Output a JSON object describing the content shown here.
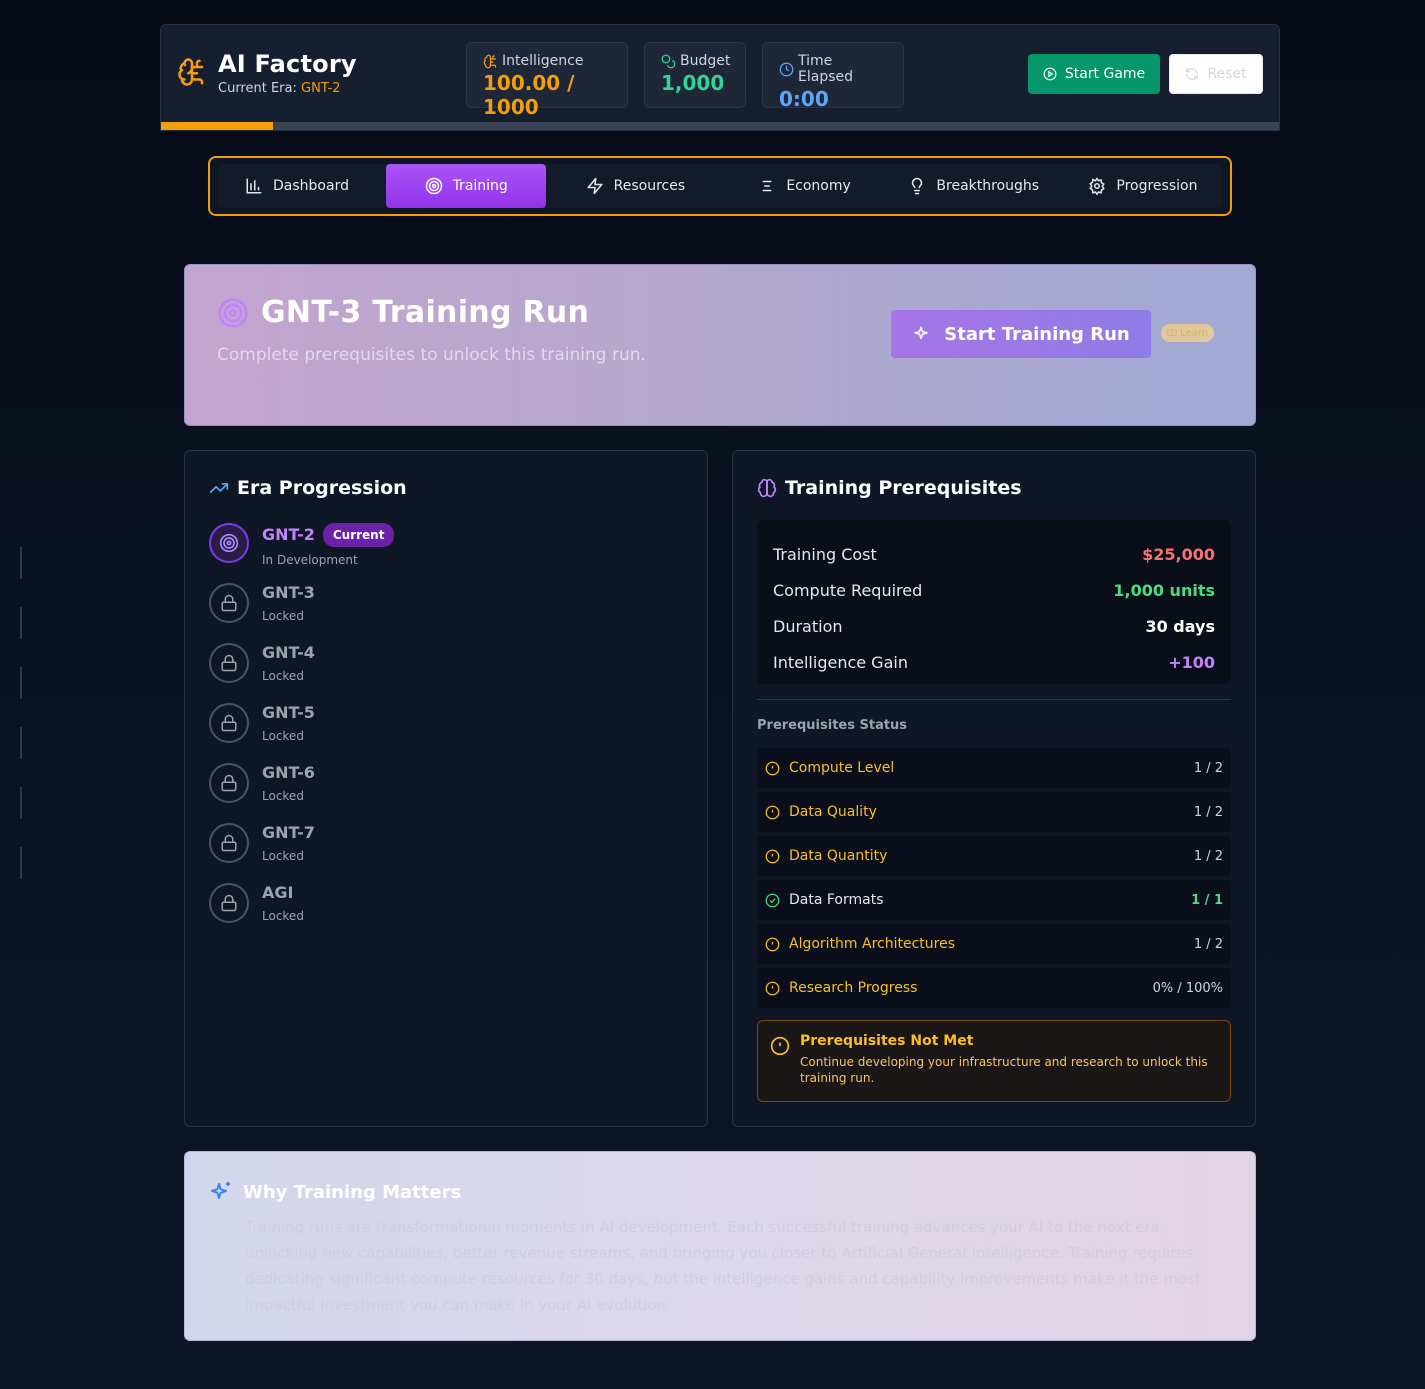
{
  "header": {
    "title": "AI Factory",
    "era_label": "Current Era:",
    "era_value": "GNT-2",
    "stats": [
      {
        "label": "Intelligence",
        "value": "100.00 / 1000",
        "icon": "brain-icon"
      },
      {
        "label": "Budget",
        "value": "1,000",
        "icon": "coins-icon"
      },
      {
        "label": "Time Elapsed",
        "value": "0:00",
        "icon": "clock-icon"
      }
    ],
    "start_label": "Start Game",
    "reset_label": "Reset",
    "progress_fraction": 0.1
  },
  "tabs": [
    {
      "label": "Dashboard",
      "icon": "bar-chart-icon",
      "active": false
    },
    {
      "label": "Training",
      "icon": "target-icon",
      "active": true
    },
    {
      "label": "Resources",
      "icon": "lightning-icon",
      "active": false
    },
    {
      "label": "Economy",
      "icon": "lines-icon",
      "active": false
    },
    {
      "label": "Breakthroughs",
      "icon": "lightbulb-icon",
      "active": false
    },
    {
      "label": "Progression",
      "icon": "gear-icon",
      "active": false
    }
  ],
  "hero": {
    "title": "GNT-3 Training Run",
    "subtitle": "Complete prerequisites to unlock this training run.",
    "button_label": "Start Training Run",
    "learn_label": "Learn"
  },
  "era_progression": {
    "title": "Era Progression",
    "items": [
      {
        "name": "GNT-2",
        "status": "In Development",
        "badge": "Current",
        "current": true
      },
      {
        "name": "GNT-3",
        "status": "Locked"
      },
      {
        "name": "GNT-4",
        "status": "Locked"
      },
      {
        "name": "GNT-5",
        "status": "Locked"
      },
      {
        "name": "GNT-6",
        "status": "Locked"
      },
      {
        "name": "GNT-7",
        "status": "Locked"
      },
      {
        "name": "AGI",
        "status": "Locked"
      }
    ]
  },
  "prerequisites": {
    "title": "Training Prerequisites",
    "costs": [
      {
        "label": "Training Cost",
        "value": "$25,000",
        "color": "#f87171"
      },
      {
        "label": "Compute Required",
        "value": "1,000 units",
        "color": "#4ade80"
      },
      {
        "label": "Duration",
        "value": "30 days",
        "color": "#ffffff"
      },
      {
        "label": "Intelligence Gain",
        "value": "+100",
        "color": "#c084fc"
      }
    ],
    "status_heading": "Prerequisites Status",
    "status": [
      {
        "label": "Compute Level",
        "value": "1 / 2",
        "met": false
      },
      {
        "label": "Data Quality",
        "value": "1 / 2",
        "met": false
      },
      {
        "label": "Data Quantity",
        "value": "1 / 2",
        "met": false
      },
      {
        "label": "Data Formats",
        "value": "1 / 1",
        "met": true
      },
      {
        "label": "Algorithm Architectures",
        "value": "1 / 2",
        "met": false
      },
      {
        "label": "Research Progress",
        "value": "0% / 100%",
        "met": false
      }
    ],
    "warning_title": "Prerequisites Not Met",
    "warning_text": "Continue developing your infrastructure and research to unlock this training run."
  },
  "why": {
    "title": "Why Training Matters",
    "text": "Training runs are transformational moments in AI development. Each successful training advances your AI to the next era, unlocking new capabilities, better revenue streams, and bringing you closer to Artificial General Intelligence. Training requires dedicating significant compute resources for 30 days, but the intelligence gains and capability improvements make it the most impactful investment you can make in your AI evolution."
  }
}
